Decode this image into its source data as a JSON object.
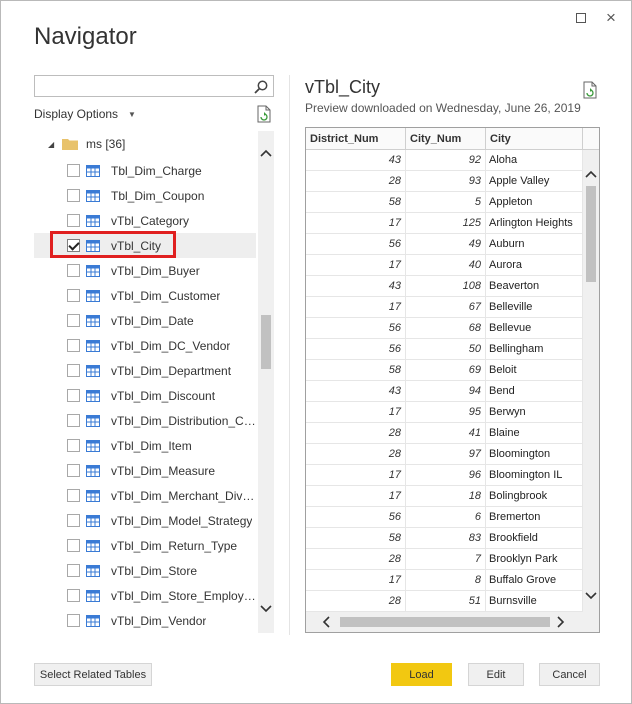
{
  "window": {
    "title": "Navigator",
    "maximize_icon": "maximize-icon",
    "close_label": "×"
  },
  "left": {
    "search": {
      "value": "",
      "placeholder": ""
    },
    "display_options_label": "Display Options",
    "folder": {
      "label": "ms [36]",
      "expanded": true
    },
    "items": [
      {
        "label": "Tbl_Dim_Charge",
        "checked": false
      },
      {
        "label": "Tbl_Dim_Coupon",
        "checked": false
      },
      {
        "label": "vTbl_Category",
        "checked": false
      },
      {
        "label": "vTbl_City",
        "checked": true
      },
      {
        "label": "vTbl_Dim_Buyer",
        "checked": false
      },
      {
        "label": "vTbl_Dim_Customer",
        "checked": false
      },
      {
        "label": "vTbl_Dim_Date",
        "checked": false
      },
      {
        "label": "vTbl_Dim_DC_Vendor",
        "checked": false
      },
      {
        "label": "vTbl_Dim_Department",
        "checked": false
      },
      {
        "label": "vTbl_Dim_Discount",
        "checked": false
      },
      {
        "label": "vTbl_Dim_Distribution_Ce...",
        "checked": false
      },
      {
        "label": "vTbl_Dim_Item",
        "checked": false
      },
      {
        "label": "vTbl_Dim_Measure",
        "checked": false
      },
      {
        "label": "vTbl_Dim_Merchant_Divisi...",
        "checked": false
      },
      {
        "label": "vTbl_Dim_Model_Strategy",
        "checked": false
      },
      {
        "label": "vTbl_Dim_Return_Type",
        "checked": false
      },
      {
        "label": "vTbl_Dim_Store",
        "checked": false
      },
      {
        "label": "vTbl_Dim_Store_Employee",
        "checked": false
      },
      {
        "label": "vTbl_Dim_Vendor",
        "checked": false
      }
    ],
    "highlight_color": "#e02020"
  },
  "preview": {
    "title": "vTbl_City",
    "subtitle": "Preview downloaded on Wednesday, June 26, 2019",
    "columns": [
      "District_Num",
      "City_Num",
      "City"
    ],
    "rows": [
      [
        "43",
        "92",
        "Aloha"
      ],
      [
        "28",
        "93",
        "Apple Valley"
      ],
      [
        "58",
        "5",
        "Appleton"
      ],
      [
        "17",
        "125",
        "Arlington Heights"
      ],
      [
        "56",
        "49",
        "Auburn"
      ],
      [
        "17",
        "40",
        "Aurora"
      ],
      [
        "43",
        "108",
        "Beaverton"
      ],
      [
        "17",
        "67",
        "Belleville"
      ],
      [
        "56",
        "68",
        "Bellevue"
      ],
      [
        "56",
        "50",
        "Bellingham"
      ],
      [
        "58",
        "69",
        "Beloit"
      ],
      [
        "43",
        "94",
        "Bend"
      ],
      [
        "17",
        "95",
        "Berwyn"
      ],
      [
        "28",
        "41",
        "Blaine"
      ],
      [
        "28",
        "97",
        "Bloomington"
      ],
      [
        "17",
        "96",
        "Bloomington IL"
      ],
      [
        "17",
        "18",
        "Bolingbrook"
      ],
      [
        "56",
        "6",
        "Bremerton"
      ],
      [
        "58",
        "83",
        "Brookfield"
      ],
      [
        "28",
        "7",
        "Brooklyn Park"
      ],
      [
        "17",
        "8",
        "Buffalo Grove"
      ],
      [
        "28",
        "51",
        "Burnsville"
      ]
    ]
  },
  "buttons": {
    "select_related": "Select Related Tables",
    "load": "Load",
    "edit": "Edit",
    "cancel": "Cancel"
  },
  "colors": {
    "load_button": "#f2c811",
    "folder": "#e8c26b",
    "table_icon": "#3a7bd5"
  }
}
